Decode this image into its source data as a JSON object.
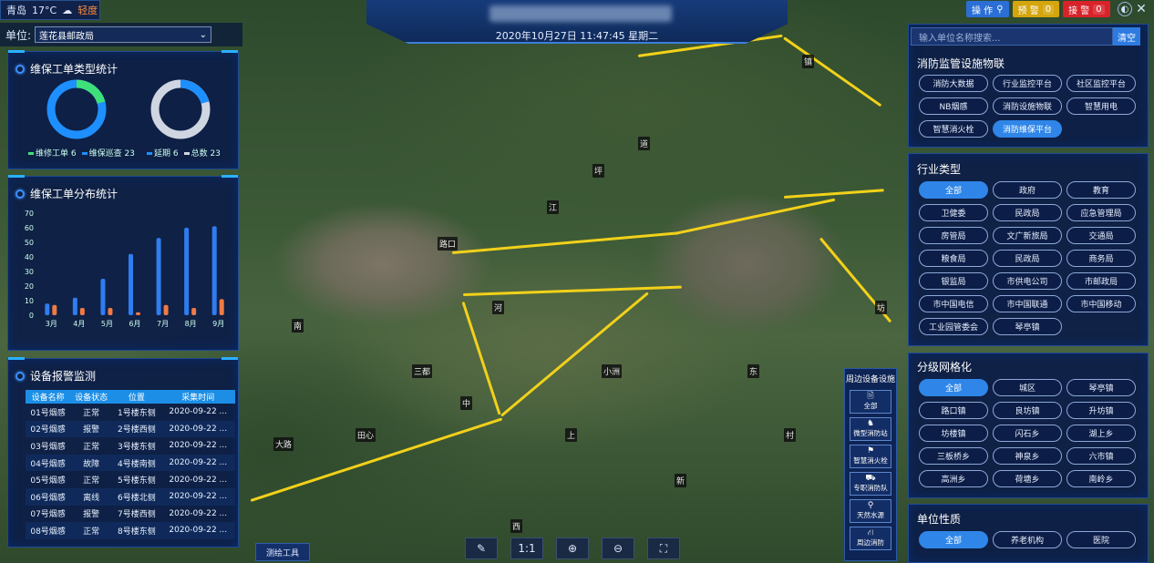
{
  "topbar": {
    "city": "青岛",
    "temperature": "17°C",
    "weather_icon": "cloud-icon",
    "air_level": "轻度",
    "datetime": "2020年10月27日 11:47:45 星期二",
    "op_label": "操 作",
    "warn_label": "预 警",
    "warn_count": "0",
    "alarm_label": "接 警",
    "alarm_count": "0",
    "close": "✕"
  },
  "unit": {
    "label": "单位:",
    "value": "莲花县邮政局"
  },
  "panel_types": {
    "title": "维保工单类型统计",
    "donut1": {
      "legend_a": "维修工单 6",
      "legend_b": "维保巡查 23",
      "a": 6,
      "b": 23
    },
    "donut2": {
      "legend_a": "延期 6",
      "legend_b": "总数 23",
      "a": 6,
      "b": 23
    },
    "colors": {
      "green": "#3ee07a",
      "blue": "#1e8fff",
      "gray": "#cfd6e2"
    }
  },
  "panel_dist": {
    "title": "维保工单分布统计"
  },
  "chart_data": {
    "type": "bar",
    "categories": [
      "3月",
      "4月",
      "5月",
      "6月",
      "7月",
      "8月",
      "9月"
    ],
    "series": [
      {
        "values": [
          8,
          12,
          25,
          42,
          53,
          60,
          61
        ],
        "color": "#2f7df0"
      },
      {
        "values": [
          7,
          5,
          5,
          2,
          7,
          5,
          11
        ],
        "color": "#f07a45"
      }
    ],
    "ylim": [
      0,
      70
    ],
    "yticks": [
      "0",
      "10",
      "20",
      "30",
      "40",
      "50",
      "60",
      "70"
    ]
  },
  "panel_alarm": {
    "title": "设备报警监测",
    "headers": [
      "设备名称",
      "设备状态",
      "位置",
      "采集时间"
    ],
    "rows": [
      [
        "01号烟感",
        "正常",
        "1号楼东侧",
        "2020-09-22 ..."
      ],
      [
        "02号烟感",
        "报警",
        "2号楼西侧",
        "2020-09-22 ..."
      ],
      [
        "03号烟感",
        "正常",
        "3号楼东侧",
        "2020-09-22 ..."
      ],
      [
        "04号烟感",
        "故障",
        "4号楼南侧",
        "2020-09-22 ..."
      ],
      [
        "05号烟感",
        "正常",
        "5号楼东侧",
        "2020-09-22 ..."
      ],
      [
        "06号烟感",
        "离线",
        "6号楼北侧",
        "2020-09-22 ..."
      ],
      [
        "07号烟感",
        "报警",
        "7号楼西侧",
        "2020-09-22 ..."
      ],
      [
        "08号烟感",
        "正常",
        "8号楼东侧",
        "2020-09-22 ..."
      ]
    ]
  },
  "search": {
    "placeholder": "输入单位名称搜索...",
    "button": "清空"
  },
  "iot": {
    "title": "消防监管设施物联",
    "items": [
      "消防大数据",
      "行业监控平台",
      "社区监控平台",
      "NB烟感",
      "消防设施物联",
      "智慧用电",
      "智慧消火栓",
      "消防维保平台"
    ],
    "active": "消防维保平台"
  },
  "industry": {
    "title": "行业类型",
    "items": [
      "全部",
      "政府",
      "教育",
      "卫健委",
      "民政局",
      "应急管理局",
      "房管局",
      "文广新旅局",
      "交通局",
      "粮食局",
      "民政局",
      "商务局",
      "银监局",
      "市供电公司",
      "市邮政局",
      "市中国电信",
      "市中国联通",
      "市中国移动",
      "工业园管委会",
      "琴亭镇"
    ],
    "active": "全部"
  },
  "grid": {
    "title": "分级网格化",
    "items": [
      "全部",
      "城区",
      "琴亭镇",
      "路口镇",
      "良坊镇",
      "升坊镇",
      "坊楼镇",
      "闪石乡",
      "湖上乡",
      "三板桥乡",
      "神泉乡",
      "六市镇",
      "高洲乡",
      "荷塘乡",
      "南岭乡"
    ],
    "active": "全部"
  },
  "nature": {
    "title": "单位性质",
    "items": [
      "全部",
      "养老机构",
      "医院"
    ],
    "active": "全部"
  },
  "nearby": {
    "title": "周边设备设施",
    "items": [
      {
        "label": "全部",
        "icon": "document-icon"
      },
      {
        "label": "微型消防站",
        "icon": "firefighter-icon"
      },
      {
        "label": "智慧消火栓",
        "icon": "hydrant-icon"
      },
      {
        "label": "专职消防队",
        "icon": "truck-icon"
      },
      {
        "label": "天然水源",
        "icon": "location-icon"
      },
      {
        "label": "周边消防",
        "icon": "road-icon"
      }
    ]
  },
  "tools": {
    "measure": "测绘工具",
    "scale": "1:1"
  },
  "map_labels": [
    "大路",
    "三都",
    "河",
    "小洲",
    "南",
    "田心",
    "江",
    "道",
    "镇",
    "坊",
    "村",
    "东",
    "上",
    "中",
    "路口",
    "西",
    "新",
    "坪"
  ]
}
